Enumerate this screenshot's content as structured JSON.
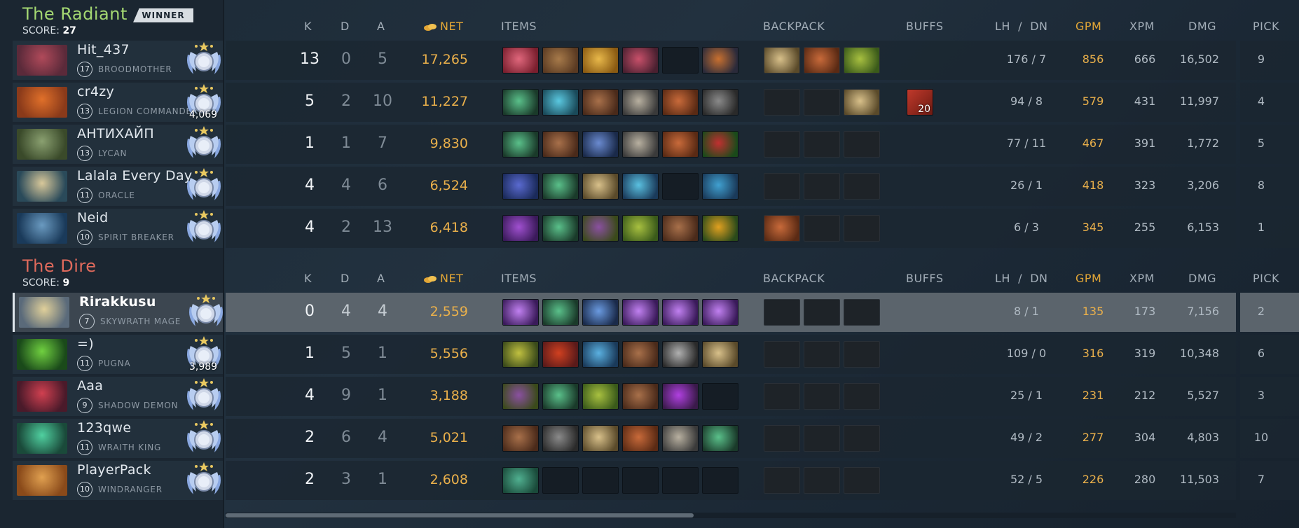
{
  "columns": {
    "k": "K",
    "d": "D",
    "a": "A",
    "net": "NET",
    "items": "ITEMS",
    "backpack": "BACKPACK",
    "buffs": "BUFFS",
    "lh": "LH",
    "slash": "/",
    "dn": "DN",
    "gpm": "GPM",
    "xpm": "XPM",
    "dmg": "DMG",
    "pick": "PICK"
  },
  "radiant": {
    "name": "The Radiant",
    "winner_label": "WINNER",
    "score_label": "SCORE:",
    "score": "27",
    "players": [
      {
        "name": "Hit_437",
        "level": "17",
        "hero": "BROODMOTHER",
        "rank": "",
        "k": "13",
        "d": "0",
        "a": "5",
        "net": "17,265",
        "lh": "176",
        "dn": "7",
        "gpm": "856",
        "xpm": "666",
        "dmg": "16,502",
        "pick": "9",
        "portrait_colors": [
          "#5b2a3a",
          "#b04a5a"
        ],
        "items": [
          [
            "#7a1f2e",
            "#e0677c"
          ],
          [
            "#5a3a22",
            "#a77a4a"
          ],
          [
            "#8a5a12",
            "#e8b84a"
          ],
          [
            "#4a2030",
            "#c8506a"
          ],
          null,
          [
            "#2a2a3a",
            "#c87030"
          ]
        ],
        "backpack": [
          [
            "#5a4a2a",
            "#d8c08a"
          ],
          [
            "#5a2a14",
            "#c86a3a"
          ],
          [
            "#3a5a1a",
            "#a8c040"
          ]
        ],
        "buff": null
      },
      {
        "name": "cr4zy",
        "level": "13",
        "hero": "LEGION COMMANDER",
        "rank": "4,069",
        "k": "5",
        "d": "2",
        "a": "10",
        "net": "11,227",
        "lh": "94",
        "dn": "8",
        "gpm": "579",
        "xpm": "431",
        "dmg": "11,997",
        "pick": "4",
        "portrait_colors": [
          "#8a3a1a",
          "#e0702a"
        ],
        "items": [
          [
            "#1a3a2a",
            "#5ac08a"
          ],
          [
            "#1a4a5a",
            "#5ac8e0"
          ],
          [
            "#4a2a1a",
            "#a8704a"
          ],
          [
            "#3a3a3a",
            "#b8b0a0"
          ],
          [
            "#5a2a14",
            "#c86a3a"
          ],
          [
            "#2a2a2a",
            "#8a8a8a"
          ]
        ],
        "backpack": [
          null,
          null,
          [
            "#5a4a2a",
            "#d8c08a"
          ]
        ],
        "buff": {
          "count": "20"
        }
      },
      {
        "name": "АНТИХАЙП",
        "level": "13",
        "hero": "LYCAN",
        "rank": "",
        "k": "1",
        "d": "1",
        "a": "7",
        "net": "9,830",
        "lh": "77",
        "dn": "11",
        "gpm": "467",
        "xpm": "391",
        "dmg": "1,772",
        "pick": "5",
        "portrait_colors": [
          "#3a4a2a",
          "#8aa070"
        ],
        "items": [
          [
            "#1a3a2a",
            "#5ac08a"
          ],
          [
            "#4a2a1a",
            "#a8704a"
          ],
          [
            "#1a2a4a",
            "#6a8ad0"
          ],
          [
            "#3a3a3a",
            "#b8b0a0"
          ],
          [
            "#5a2a14",
            "#c86a3a"
          ],
          [
            "#1a4a1a",
            "#c03030"
          ]
        ],
        "backpack": [
          null,
          null,
          null
        ],
        "buff": null
      },
      {
        "name": "Lalala Every Day",
        "level": "11",
        "hero": "ORACLE",
        "rank": "",
        "k": "4",
        "d": "4",
        "a": "6",
        "net": "6,524",
        "lh": "26",
        "dn": "1",
        "gpm": "418",
        "xpm": "323",
        "dmg": "3,206",
        "pick": "8",
        "portrait_colors": [
          "#2a4a5a",
          "#d8c89a"
        ],
        "items": [
          [
            "#1a2a5a",
            "#5a6ad0"
          ],
          [
            "#1a3a2a",
            "#5ac08a"
          ],
          [
            "#5a4a2a",
            "#d8c08a"
          ],
          [
            "#1a3a5a",
            "#5ac0e0"
          ],
          null,
          [
            "#1a3a5a",
            "#40a0d0"
          ]
        ],
        "backpack": [
          null,
          null,
          null
        ],
        "buff": null
      },
      {
        "name": "Neid",
        "level": "10",
        "hero": "SPIRIT BREAKER",
        "rank": "",
        "k": "4",
        "d": "2",
        "a": "13",
        "net": "6,418",
        "lh": "6",
        "dn": "3",
        "gpm": "345",
        "xpm": "255",
        "dmg": "6,153",
        "pick": "1",
        "portrait_colors": [
          "#1a3a5a",
          "#6a9ac0"
        ],
        "items": [
          [
            "#3a1a5a",
            "#a050d0"
          ],
          [
            "#1a3a2a",
            "#5ac08a"
          ],
          [
            "#3a4a1a",
            "#8a50a0"
          ],
          [
            "#3a5a1a",
            "#a8c040"
          ],
          [
            "#4a2a1a",
            "#a8704a"
          ],
          [
            "#2a4a1a",
            "#e0a020"
          ]
        ],
        "backpack": [
          [
            "#5a2a14",
            "#c86a3a"
          ],
          null,
          null
        ],
        "buff": null
      }
    ]
  },
  "dire": {
    "name": "The Dire",
    "score_label": "SCORE:",
    "score": "9",
    "players": [
      {
        "name": "Rirakkusu",
        "level": "7",
        "hero": "SKYWRATH MAGE",
        "rank": "",
        "k": "0",
        "d": "4",
        "a": "4",
        "net": "2,559",
        "lh": "8",
        "dn": "1",
        "gpm": "135",
        "xpm": "173",
        "dmg": "7,156",
        "pick": "2",
        "highlight": true,
        "portrait_colors": [
          "#5a6a7a",
          "#e0d09a"
        ],
        "items": [
          [
            "#3a1a5a",
            "#c080f0"
          ],
          [
            "#1a3a2a",
            "#5ac08a"
          ],
          [
            "#1a2a4a",
            "#6a9ae0"
          ],
          [
            "#3a1a5a",
            "#c080f0"
          ],
          [
            "#3a1a5a",
            "#c080f0"
          ],
          [
            "#3a1a5a",
            "#c080f0"
          ]
        ],
        "backpack": [
          null,
          null,
          null
        ],
        "buff": null
      },
      {
        "name": "=)",
        "level": "11",
        "hero": "PUGNA",
        "rank": "3,989",
        "k": "1",
        "d": "5",
        "a": "1",
        "net": "5,556",
        "lh": "109",
        "dn": "0",
        "gpm": "316",
        "xpm": "319",
        "dmg": "10,348",
        "pick": "6",
        "portrait_colors": [
          "#1a4a1a",
          "#70d040"
        ],
        "items": [
          [
            "#3a4a1a",
            "#c0c040"
          ],
          [
            "#5a1a1a",
            "#d04020"
          ],
          [
            "#1a3a5a",
            "#5ab0e0"
          ],
          [
            "#4a2a1a",
            "#a8704a"
          ],
          [
            "#2a2a2a",
            "#b0b0b0"
          ],
          [
            "#5a4a2a",
            "#d8c08a"
          ]
        ],
        "backpack": [
          null,
          null,
          null
        ],
        "buff": null
      },
      {
        "name": "Aaa",
        "level": "9",
        "hero": "SHADOW DEMON",
        "rank": "",
        "k": "4",
        "d": "9",
        "a": "1",
        "net": "3,188",
        "lh": "25",
        "dn": "1",
        "gpm": "231",
        "xpm": "212",
        "dmg": "5,527",
        "pick": "3",
        "portrait_colors": [
          "#4a1a2a",
          "#d04050"
        ],
        "items": [
          [
            "#3a4a1a",
            "#8a50a0"
          ],
          [
            "#1a3a2a",
            "#5ac08a"
          ],
          [
            "#3a5a1a",
            "#a8c040"
          ],
          [
            "#4a2a1a",
            "#a8704a"
          ],
          [
            "#3a1a4a",
            "#b040e0"
          ],
          null
        ],
        "backpack": [
          null,
          null,
          null
        ],
        "buff": null
      },
      {
        "name": "123qwe",
        "level": "11",
        "hero": "WRAITH KING",
        "rank": "",
        "k": "2",
        "d": "6",
        "a": "4",
        "net": "5,021",
        "lh": "49",
        "dn": "2",
        "gpm": "277",
        "xpm": "304",
        "dmg": "4,803",
        "pick": "10",
        "portrait_colors": [
          "#1a4a3a",
          "#50d0a0"
        ],
        "items": [
          [
            "#4a2a1a",
            "#a8704a"
          ],
          [
            "#2a2a2a",
            "#8a8a8a"
          ],
          [
            "#5a4a2a",
            "#d8c08a"
          ],
          [
            "#5a2a14",
            "#c86a3a"
          ],
          [
            "#3a3a3a",
            "#b8b0a0"
          ],
          [
            "#1a3a2a",
            "#5ac08a"
          ]
        ],
        "backpack": [
          null,
          null,
          null
        ],
        "buff": null
      },
      {
        "name": "PlayerPack",
        "level": "10",
        "hero": "WINDRANGER",
        "rank": "",
        "k": "2",
        "d": "3",
        "a": "1",
        "net": "2,608",
        "lh": "52",
        "dn": "5",
        "gpm": "226",
        "xpm": "280",
        "dmg": "11,503",
        "pick": "7",
        "portrait_colors": [
          "#8a4a1a",
          "#e0a050"
        ],
        "items": [
          [
            "#1a4a3a",
            "#50b090"
          ],
          null,
          null,
          null,
          null,
          null
        ],
        "backpack": [
          null,
          null,
          null
        ],
        "buff": null
      }
    ]
  }
}
